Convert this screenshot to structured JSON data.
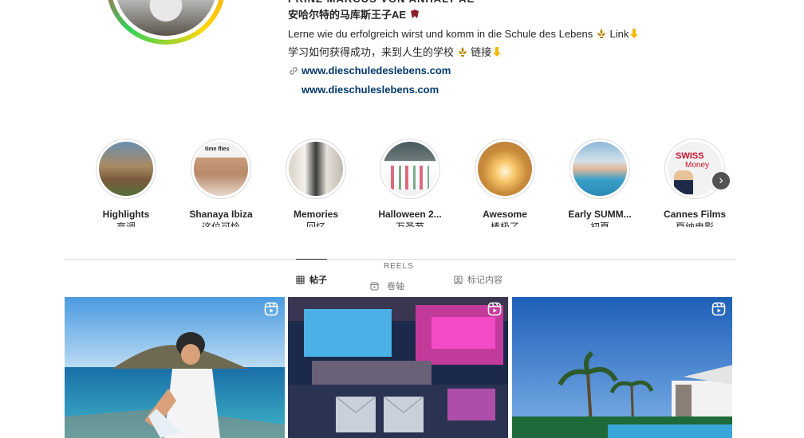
{
  "profile": {
    "name_top": "PRINZ MARCUS VON ANHALT AE",
    "name_cn": "安哈尔特的马库斯王子AE",
    "bio_de": "Lerne wie du erfolgreich wirst und komm in die Schule des Lebens",
    "bio_de_link": "Link",
    "bio_cn": "学习如何获得成功，来到人生的学校",
    "bio_cn_link": "链接",
    "link1": "www.dieschuledeslebens.com",
    "link2": "www.dieschuleslebens.com"
  },
  "highlights": [
    {
      "label": "Highlights",
      "sub": "亮调"
    },
    {
      "label": "Shanaya Ibiza",
      "sub": "这位可怜"
    },
    {
      "label": "Memories",
      "sub": "回忆"
    },
    {
      "label": "Halloween 2...",
      "sub": "万圣节"
    },
    {
      "label": "Awesome",
      "sub": "棒极了"
    },
    {
      "label": "Early SUMM...",
      "sub": "初夏"
    },
    {
      "label": "Cannes Films",
      "sub": "戛纳电影"
    }
  ],
  "highlight_overlay": {
    "time_flies": "time flies",
    "swiss": "SWISS",
    "money": "Money"
  },
  "tabs": {
    "posts": "帖子",
    "reels_top": "REELS",
    "reels": "卷轴",
    "tagged": "标记内容"
  },
  "icons": {
    "link": "link-icon",
    "next": "chevron-right-icon",
    "posts": "grid-icon",
    "reels": "reels-icon",
    "tagged": "tag-icon"
  }
}
